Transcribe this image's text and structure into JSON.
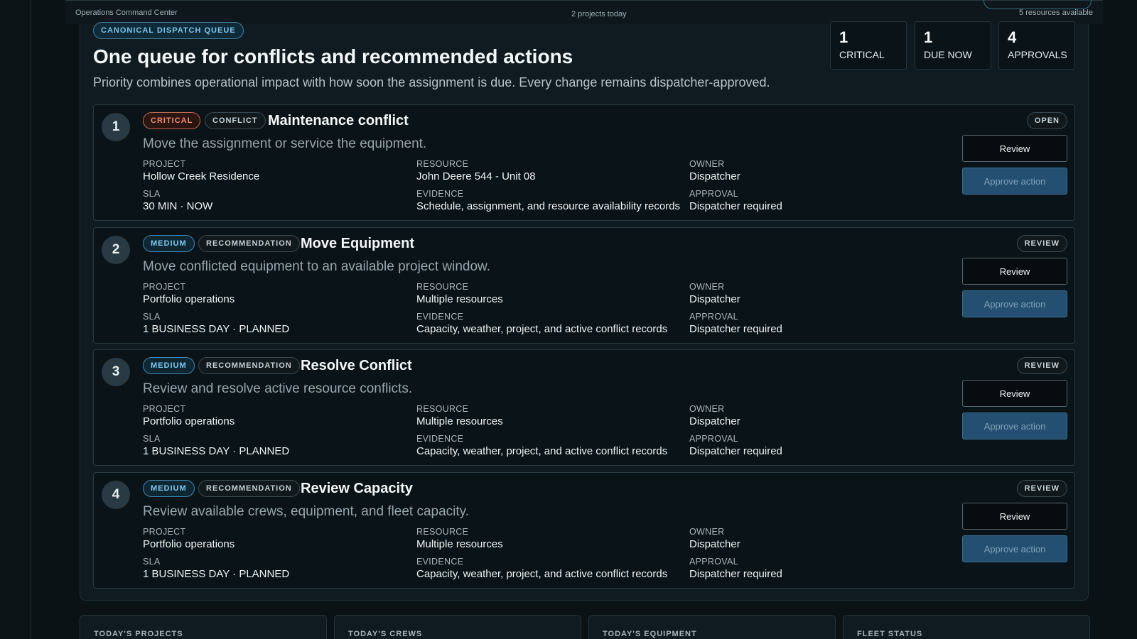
{
  "topbar": {
    "app_name": "Operations Command Center",
    "projects_today": "2 projects today",
    "resources_available": "5 resources available"
  },
  "header": {
    "queue_tag": "CANONICAL DISPATCH QUEUE",
    "title": "One queue for conflicts and recommended actions",
    "subtitle": "Priority combines operational impact with how soon the assignment is due. Every change remains dispatcher-approved."
  },
  "stats": [
    {
      "value": "1",
      "label": "CRITICAL"
    },
    {
      "value": "1",
      "label": "DUE NOW"
    },
    {
      "value": "4",
      "label": "APPROVALS"
    }
  ],
  "labels": {
    "project": "PROJECT",
    "resource": "RESOURCE",
    "owner": "OWNER",
    "sla": "SLA",
    "evidence": "EVIDENCE",
    "approval": "APPROVAL",
    "review_button": "Review",
    "approve_button": "Approve action"
  },
  "queue": [
    {
      "rank": "1",
      "severity": "CRITICAL",
      "type": "CONFLICT",
      "title": "Maintenance conflict",
      "description": "Move the assignment or service the equipment.",
      "project": "Hollow Creek Residence",
      "resource": "John Deere 544 - Unit 08",
      "owner": "Dispatcher",
      "sla": "30 MIN · NOW",
      "evidence": "Schedule, assignment, and resource availability records",
      "approval": "Dispatcher required",
      "status": "OPEN"
    },
    {
      "rank": "2",
      "severity": "MEDIUM",
      "type": "RECOMMENDATION",
      "title": "Move Equipment",
      "description": "Move conflicted equipment to an available project window.",
      "project": "Portfolio operations",
      "resource": "Multiple resources",
      "owner": "Dispatcher",
      "sla": "1 BUSINESS DAY · PLANNED",
      "evidence": "Capacity, weather, project, and active conflict records",
      "approval": "Dispatcher required",
      "status": "REVIEW"
    },
    {
      "rank": "3",
      "severity": "MEDIUM",
      "type": "RECOMMENDATION",
      "title": "Resolve Conflict",
      "description": "Review and resolve active resource conflicts.",
      "project": "Portfolio operations",
      "resource": "Multiple resources",
      "owner": "Dispatcher",
      "sla": "1 BUSINESS DAY · PLANNED",
      "evidence": "Capacity, weather, project, and active conflict records",
      "approval": "Dispatcher required",
      "status": "REVIEW"
    },
    {
      "rank": "4",
      "severity": "MEDIUM",
      "type": "RECOMMENDATION",
      "title": "Review Capacity",
      "description": "Review available crews, equipment, and fleet capacity.",
      "project": "Portfolio operations",
      "resource": "Multiple resources",
      "owner": "Dispatcher",
      "sla": "1 BUSINESS DAY · PLANNED",
      "evidence": "Capacity, weather, project, and active conflict records",
      "approval": "Dispatcher required",
      "status": "REVIEW"
    }
  ],
  "bottom_cards": [
    {
      "label": "TODAY'S PROJECTS"
    },
    {
      "label": "TODAY'S CREWS"
    },
    {
      "label": "TODAY'S EQUIPMENT"
    },
    {
      "label": "FLEET STATUS"
    }
  ],
  "colors": {
    "background": "#0a1216",
    "critical": "#f08f74",
    "accent": "#7ecaf0",
    "approve": "#244f70"
  }
}
